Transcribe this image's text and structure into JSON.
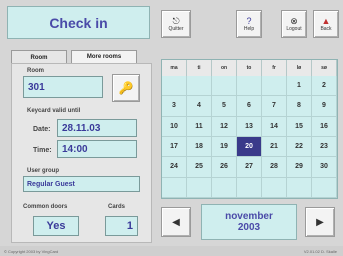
{
  "header": {
    "title": "Check in"
  },
  "toolbar": {
    "quit_label": "Quitter",
    "help_label": "Help",
    "logout_label": "Logout",
    "back_label": "Back"
  },
  "tabs": [
    {
      "label": "Room"
    },
    {
      "label": "More rooms"
    }
  ],
  "form": {
    "room_label": "Room",
    "room_value": "301",
    "keycard_label": "Keycard valid until",
    "date_label": "Date:",
    "date_value": "28.11.03",
    "time_label": "Time:",
    "time_value": "14:00",
    "user_group_label": "User group",
    "user_group_value": "Regular Guest",
    "common_doors_label": "Common doors",
    "common_doors_value": "Yes",
    "cards_label": "Cards",
    "cards_value": "1"
  },
  "calendar": {
    "weekdays": [
      "ma",
      "ti",
      "on",
      "to",
      "fr",
      "lø",
      "sø"
    ],
    "weeks": [
      [
        "",
        "",
        "",
        "",
        "",
        "1",
        "2"
      ],
      [
        "3",
        "4",
        "5",
        "6",
        "7",
        "8",
        "9"
      ],
      [
        "10",
        "11",
        "12",
        "13",
        "14",
        "15",
        "16"
      ],
      [
        "17",
        "18",
        "19",
        "20",
        "21",
        "22",
        "23"
      ],
      [
        "24",
        "25",
        "26",
        "27",
        "28",
        "29",
        "30"
      ],
      [
        "",
        "",
        "",
        "",
        "",
        "",
        ""
      ]
    ],
    "month": "november",
    "year": "2003",
    "selected_day": "20"
  },
  "status_bar": {
    "left": "© Copyright 2003 by VingCard",
    "right": "V2.01.02   D. Skalle"
  }
}
